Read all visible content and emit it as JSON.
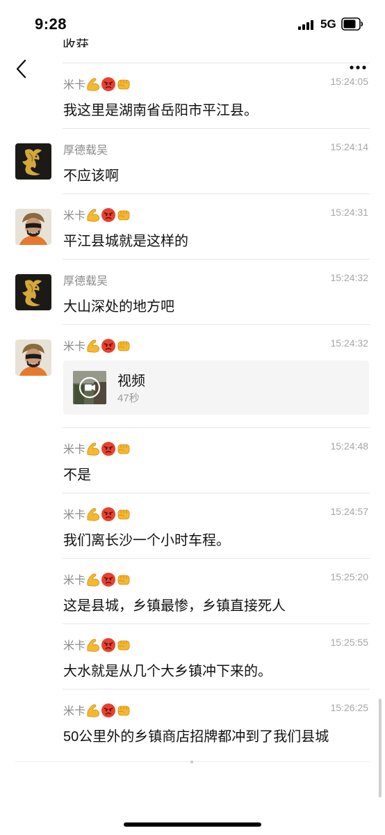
{
  "status_bar": {
    "time": "9:28",
    "network": "5G"
  },
  "top_fragment_text": "收获",
  "icons": {
    "back": "chevron-left-icon",
    "more": "more-dots-icon",
    "video": "video-camera-icon"
  },
  "colors": {
    "sender": "#8a8a8a",
    "time": "#a6a6a6",
    "card_bg": "#f5f5f5"
  },
  "messages": [
    {
      "sender": "米卡",
      "sender_emoji": [
        "flexed-biceps",
        "angry-face",
        "fist"
      ],
      "time": "15:24:05",
      "text": "我这里是湖南省岳阳市平江县。",
      "avatar": "none"
    },
    {
      "sender": "厚德载吴",
      "time": "15:24:14",
      "text": "不应该啊",
      "avatar": "gold-dragon-avatar"
    },
    {
      "sender": "米卡",
      "sender_emoji": [
        "flexed-biceps",
        "angry-face",
        "fist"
      ],
      "time": "15:24:31",
      "text": "平江县城就是这样的",
      "avatar": "masked-person-avatar"
    },
    {
      "sender": "厚德载吴",
      "time": "15:24:32",
      "text": "大山深处的地方吧",
      "avatar": "gold-dragon-avatar"
    },
    {
      "sender": "米卡",
      "sender_emoji": [
        "flexed-biceps",
        "angry-face",
        "fist"
      ],
      "time": "15:24:32",
      "type": "video",
      "video_title": "视频",
      "video_duration": "47秒",
      "avatar": "masked-person-avatar"
    },
    {
      "sender": "米卡",
      "sender_emoji": [
        "flexed-biceps",
        "angry-face",
        "fist"
      ],
      "time": "15:24:48",
      "text": "不是",
      "avatar": "none"
    },
    {
      "sender": "米卡",
      "sender_emoji": [
        "flexed-biceps",
        "angry-face",
        "fist"
      ],
      "time": "15:24:57",
      "text": "我们离长沙一个小时车程。",
      "avatar": "none"
    },
    {
      "sender": "米卡",
      "sender_emoji": [
        "flexed-biceps",
        "angry-face",
        "fist"
      ],
      "time": "15:25:20",
      "text": "这是县城，乡镇最惨，乡镇直接死人",
      "avatar": "none"
    },
    {
      "sender": "米卡",
      "sender_emoji": [
        "flexed-biceps",
        "angry-face",
        "fist"
      ],
      "time": "15:25:55",
      "text": "大水就是从几个大乡镇冲下来的。",
      "avatar": "none"
    },
    {
      "sender": "米卡",
      "sender_emoji": [
        "flexed-biceps",
        "angry-face",
        "fist"
      ],
      "time": "15:26:25",
      "text": "50公里外的乡镇商店招牌都冲到了我们县城",
      "avatar": "none"
    }
  ]
}
